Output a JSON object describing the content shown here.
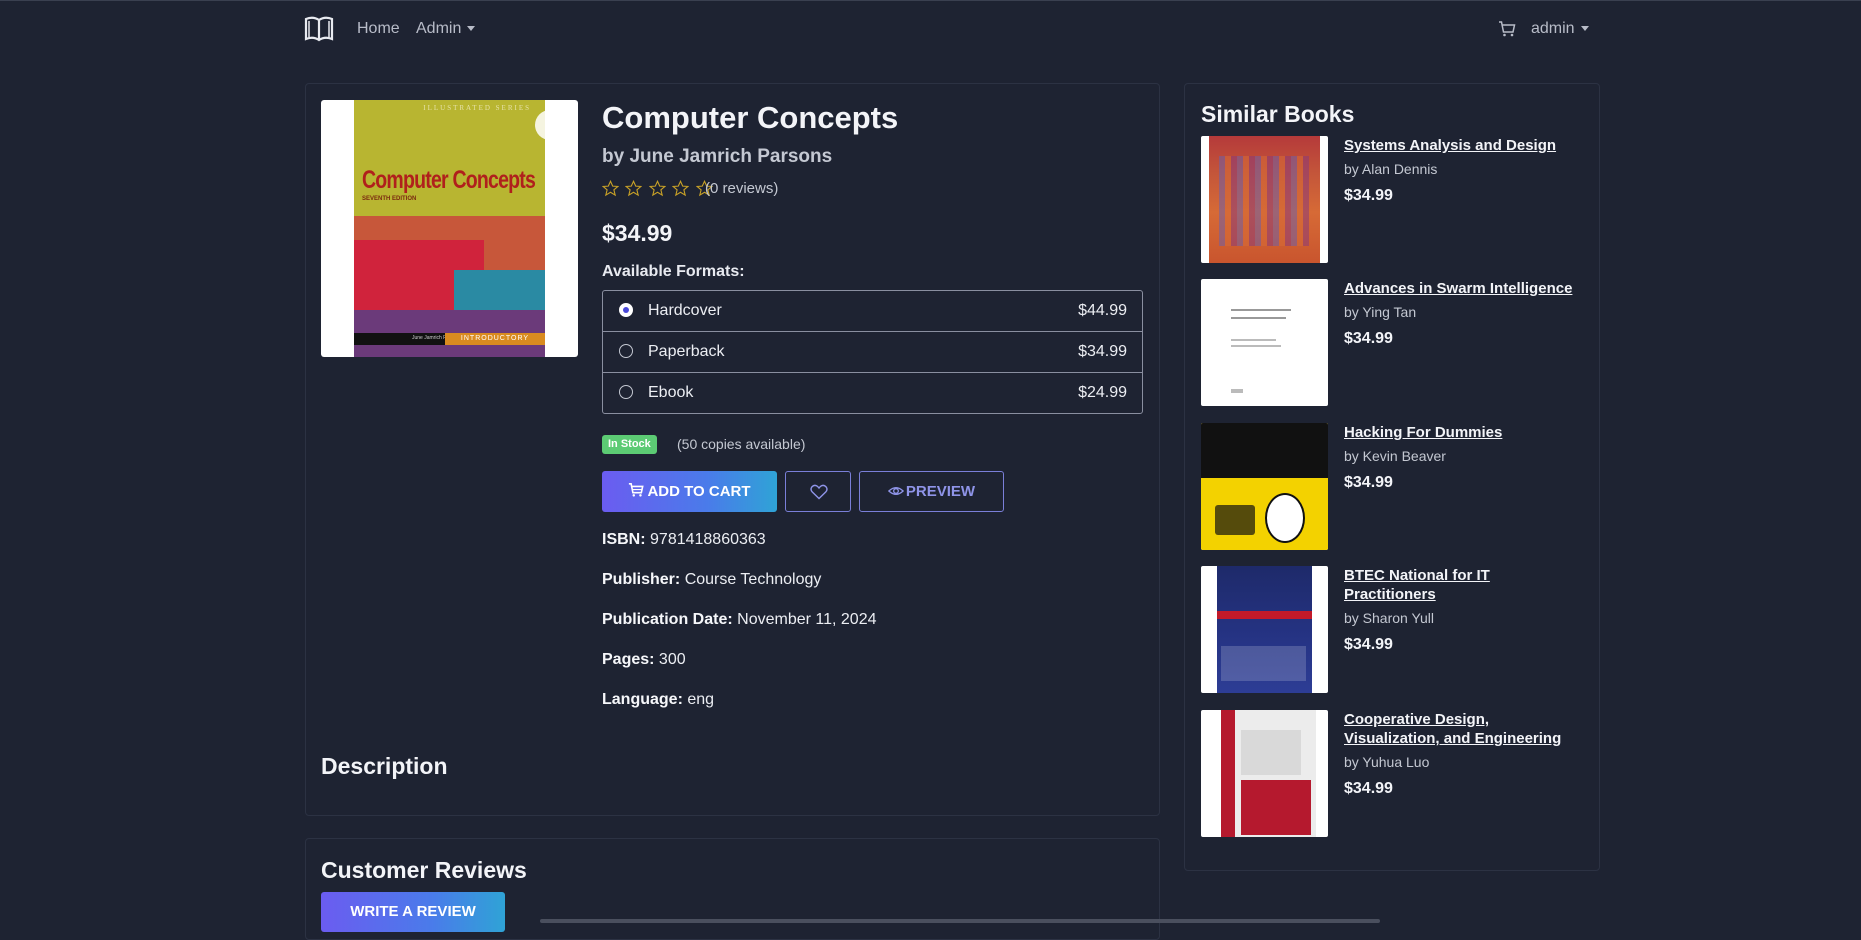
{
  "nav": {
    "home": "Home",
    "admin": "Admin",
    "user": "admin"
  },
  "book": {
    "title": "Computer Concepts",
    "author": "by June Jamrich Parsons",
    "reviews_count": "(0 reviews)",
    "rating": 0,
    "price": "$34.99",
    "cover_text": {
      "series": "ILLUSTRATED SERIES",
      "title": "Computer Concepts",
      "edition": "SEVENTH EDITION",
      "authors": "June Jamrich Parsons | Dan Oja",
      "tag": "INTRODUCTORY"
    }
  },
  "formats": {
    "label": "Available Formats:",
    "items": [
      {
        "name": "Hardcover",
        "price": "$44.99",
        "selected": true
      },
      {
        "name": "Paperback",
        "price": "$34.99",
        "selected": false
      },
      {
        "name": "Ebook",
        "price": "$24.99",
        "selected": false
      }
    ]
  },
  "stock": {
    "badge": "In Stock",
    "copies": "(50 copies available)"
  },
  "actions": {
    "add_to_cart": "ADD TO CART",
    "preview": "PREVIEW"
  },
  "meta": {
    "isbn_label": "ISBN:",
    "isbn": "9781418860363",
    "publisher_label": "Publisher:",
    "publisher": "Course Technology",
    "pubdate_label": "Publication Date:",
    "pubdate": "November 11, 2024",
    "pages_label": "Pages:",
    "pages": "300",
    "language_label": "Language:",
    "language": "eng"
  },
  "description": {
    "heading": "Description"
  },
  "reviews": {
    "heading": "Customer Reviews",
    "write": "WRITE A REVIEW"
  },
  "similar": {
    "heading": "Similar Books",
    "items": [
      {
        "title": "Systems Analysis and Design",
        "author": "by Alan Dennis",
        "price": "$34.99"
      },
      {
        "title": "Advances in Swarm Intelligence",
        "author": "by Ying Tan",
        "price": "$34.99"
      },
      {
        "title": "Hacking For Dummies",
        "author": "by Kevin Beaver",
        "price": "$34.99"
      },
      {
        "title": "BTEC National for IT Practitioners",
        "author": "by Sharon Yull",
        "price": "$34.99"
      },
      {
        "title": "Cooperative Design, Visualization, and Engineering",
        "author": "by Yuhua Luo",
        "price": "$34.99"
      }
    ]
  },
  "colors": {
    "background": "#1e2332",
    "accent_gradient_start": "#6b5cf0",
    "accent_gradient_end": "#2fa3d6",
    "in_stock": "#5ccb74",
    "star_outline": "#c9a227"
  }
}
